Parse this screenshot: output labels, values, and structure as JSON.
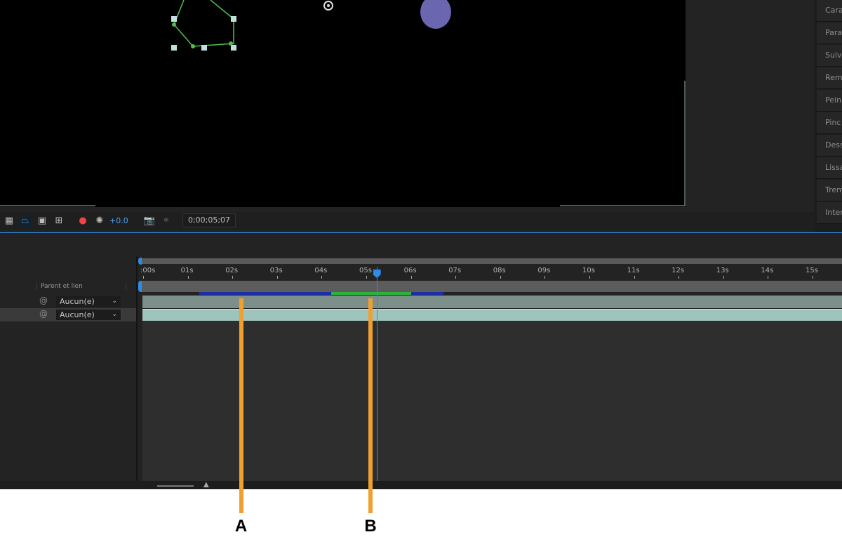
{
  "right_panel": {
    "items": [
      "Cara",
      "Para",
      "Suiv",
      "Rem",
      "Pein",
      "Pinc",
      "Dess",
      "Lissa",
      "Trem",
      "Inter"
    ]
  },
  "viewer_toolbar": {
    "exposure": "+0.0",
    "timecode": "0;00;05;07"
  },
  "timeline": {
    "column_header": "Parent et lien",
    "layers": [
      {
        "parent": "Aucun(e)"
      },
      {
        "parent": "Aucun(e)"
      }
    ],
    "ruler_labels": [
      ":00s",
      "01s",
      "02s",
      "03s",
      "04s",
      "05s",
      "06s",
      "07s",
      "08s",
      "09s",
      "10s",
      "11s",
      "12s",
      "13s",
      "14s",
      "15s"
    ],
    "current_time_seconds": 5.23,
    "accent": "#2d8ceb"
  },
  "annotations": [
    {
      "label": "A",
      "time_seconds": 2.2
    },
    {
      "label": "B",
      "time_seconds": 5.1
    }
  ]
}
